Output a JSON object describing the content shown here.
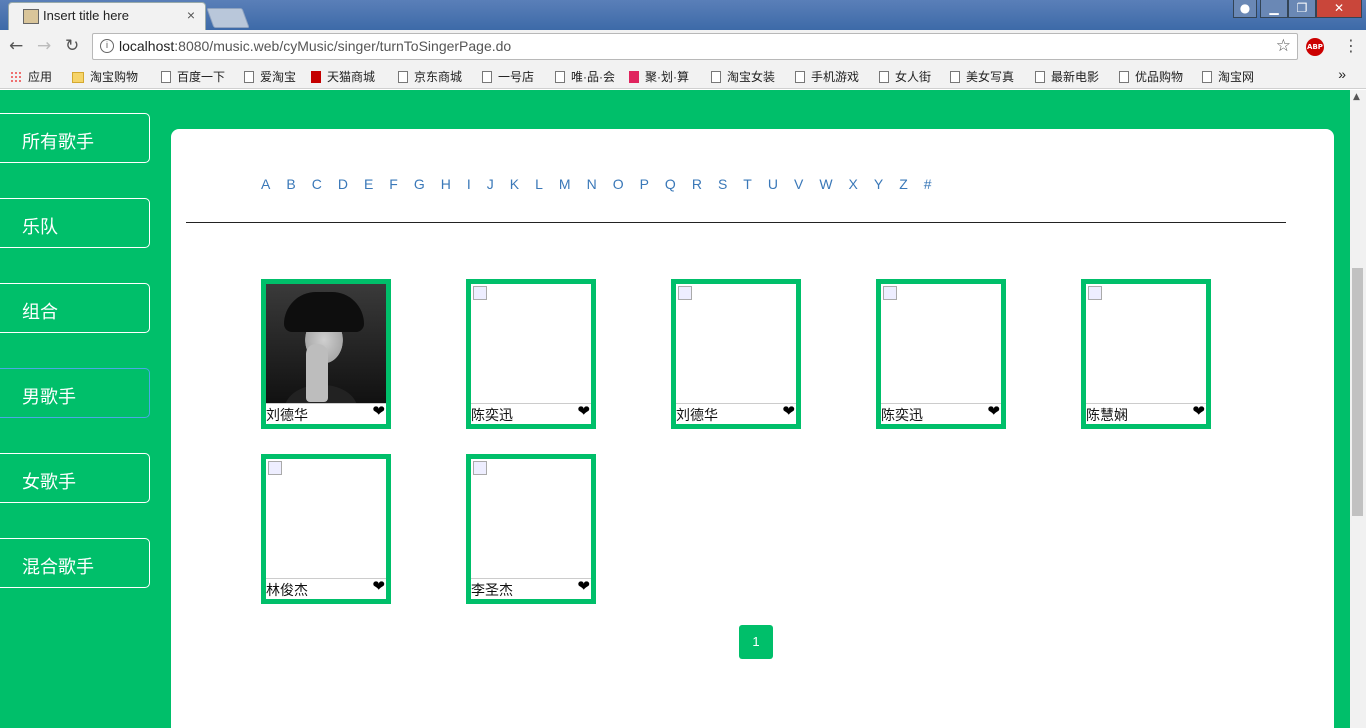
{
  "browser": {
    "tab_title": "Insert title here",
    "tab_close": "×",
    "url_host": "localhost",
    "url_rest": ":8080/music.web/cyMusic/singer/turnToSingerPage.do",
    "abp_label": "ABP",
    "bookmarks": [
      "应用",
      "淘宝购物",
      "百度一下",
      "爱淘宝",
      "天猫商城",
      "京东商城",
      "一号店",
      "唯·品·会",
      "聚·划·算",
      "淘宝女装",
      "手机游戏",
      "女人街",
      "美女写真",
      "最新电影",
      "优品购物",
      "淘宝网"
    ],
    "bookmarks_more": "»"
  },
  "sidebar": {
    "items": [
      "所有歌手",
      "乐队",
      "组合",
      "男歌手",
      "女歌手",
      "混合歌手"
    ],
    "active_index": 3
  },
  "alphabet": [
    "A",
    "B",
    "C",
    "D",
    "E",
    "F",
    "G",
    "H",
    "I",
    "J",
    "K",
    "L",
    "M",
    "N",
    "O",
    "P",
    "Q",
    "R",
    "S",
    "T",
    "U",
    "V",
    "W",
    "X",
    "Y",
    "Z",
    "#"
  ],
  "singers": [
    {
      "name": "刘德华",
      "has_photo": true
    },
    {
      "name": "陈奕迅",
      "has_photo": false
    },
    {
      "name": "刘德华",
      "has_photo": false
    },
    {
      "name": "陈奕迅",
      "has_photo": false
    },
    {
      "name": "陈慧娴",
      "has_photo": false
    },
    {
      "name": "林俊杰",
      "has_photo": false
    },
    {
      "name": "李圣杰",
      "has_photo": false
    }
  ],
  "heart_glyph": "❤",
  "pagination": {
    "current": "1"
  },
  "colors": {
    "accent": "#00bf6a",
    "letter_link": "#3a78b8"
  }
}
